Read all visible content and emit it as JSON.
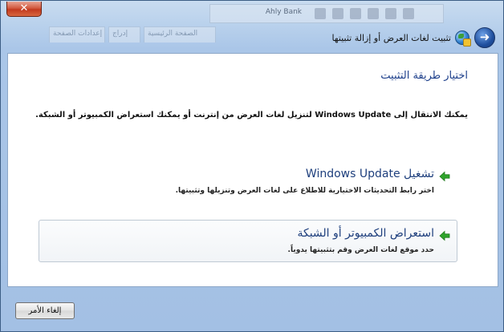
{
  "window": {
    "title": "تثبيت لغات العرض أو إزالة تثبيتها",
    "close_glyph": "✕",
    "back_glyph": "➜"
  },
  "background": {
    "tabs": [
      "إعدادات الصفحة",
      "إدراج",
      "الصفحة الرئيسية"
    ],
    "toolbar_label": "Ahly Bank"
  },
  "main": {
    "heading": "اختيار طريقة التثبيت",
    "intro": "يمكنك الانتقال إلى Windows Update لتنزيل لغات العرض من إنترنت أو يمكنك استعراض الكمبيوتر أو الشبكة.",
    "options": [
      {
        "title": "تشغيل Windows Update",
        "description": "اختر رابط التحديثات الاختيارية للاطلاع على لغات العرض وتنزيلها وتثبيتها."
      },
      {
        "title": "استعراض الكمبيوتر أو الشبكة",
        "description": "حدد موقع لغات العرض وقم بتثبيتها يدوياً."
      }
    ]
  },
  "footer": {
    "cancel_label": "إلغاء الأمر"
  },
  "colors": {
    "accent_text": "#1e3f7d",
    "arrow_green": "#2fa52b"
  }
}
